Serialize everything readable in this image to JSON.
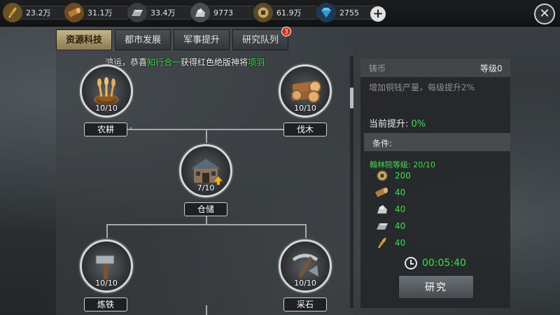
{
  "topbar": {
    "resources": [
      {
        "name": "food",
        "icon": "wheat-icon",
        "value": "23.2万"
      },
      {
        "name": "wood",
        "icon": "log-icon",
        "value": "31.1万"
      },
      {
        "name": "iron",
        "icon": "iron-ingot-icon",
        "value": "33.4万"
      },
      {
        "name": "stone",
        "icon": "stone-icon",
        "value": "9773"
      },
      {
        "name": "copper",
        "icon": "coin-icon",
        "value": "61.9万"
      },
      {
        "name": "gems",
        "icon": "diamond-icon",
        "value": "2755"
      }
    ],
    "plus_label": "+",
    "close_label": "✕"
  },
  "tabs": [
    {
      "label": "资源科技",
      "active": true
    },
    {
      "label": "都市发展",
      "active": false
    },
    {
      "label": "军事提升",
      "active": false
    },
    {
      "label": "研究队列",
      "active": false,
      "badge": "3"
    }
  ],
  "notice": {
    "part1": "鸿运，恭喜",
    "name": "知行合一",
    "part2": "获得红色绝版神将",
    "hero": "项羽"
  },
  "tree": {
    "nodes": [
      {
        "id": "farming",
        "label": "农耕",
        "level": "10/10",
        "icon": "wheat-basket-icon"
      },
      {
        "id": "logging",
        "label": "伐木",
        "level": "10/10",
        "icon": "logs-icon"
      },
      {
        "id": "storage",
        "label": "仓储",
        "level": "7/10",
        "icon": "warehouse-icon"
      },
      {
        "id": "smelting",
        "label": "炼铁",
        "level": "10/10",
        "icon": "hammer-icon"
      },
      {
        "id": "quarrying",
        "label": "采石",
        "level": "10/10",
        "icon": "pickaxe-icon"
      }
    ]
  },
  "info": {
    "name": "铸币",
    "level_text": "等级0",
    "description": "增加铜钱产量，每级提升2%",
    "current_label": "当前提升:",
    "current_value": "0%",
    "conditions_label": "条件:",
    "requirement": "翰林院等级: 20/10",
    "costs": [
      {
        "icon": "coin-icon",
        "value": "200"
      },
      {
        "icon": "log-icon",
        "value": "40"
      },
      {
        "icon": "stone-icon",
        "value": "40"
      },
      {
        "icon": "iron-ingot-icon",
        "value": "40"
      },
      {
        "icon": "wheat-icon",
        "value": "40"
      }
    ],
    "time": "00:05:40",
    "research_button": "研究"
  },
  "colors": {
    "accent_green": "#39e04b",
    "tab_active": "#c7b487",
    "badge_red": "#d62a1e"
  }
}
